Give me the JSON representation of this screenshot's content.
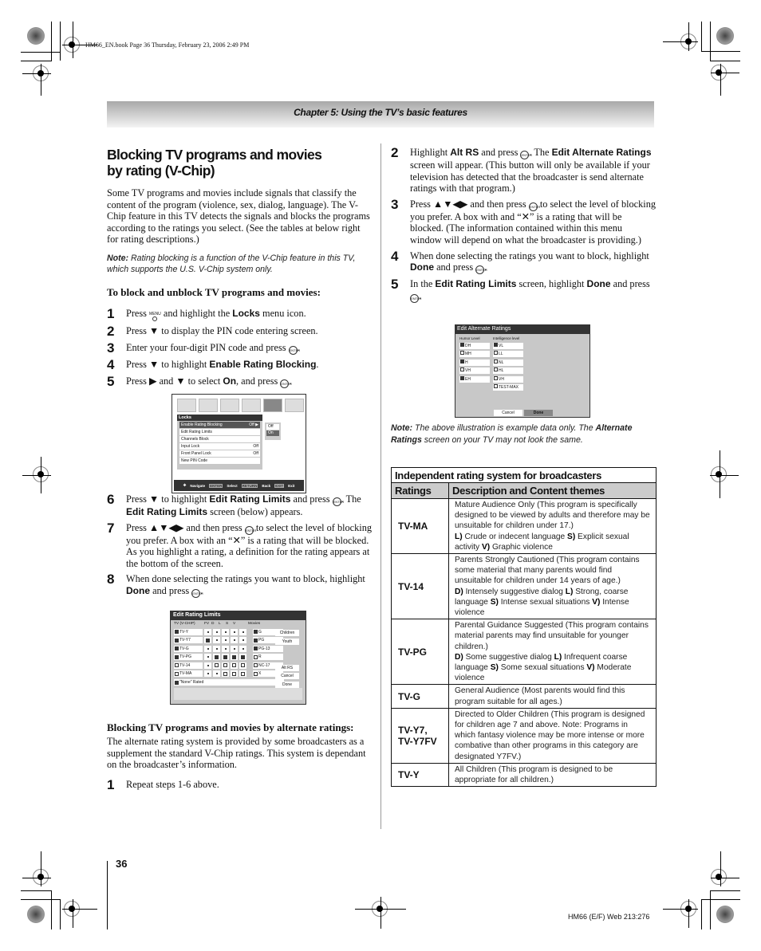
{
  "slug": "HM66_EN.book  Page 36  Thursday, February 23, 2006  2:49 PM",
  "chapter_header": "Chapter 5: Using the TV’s basic features",
  "left": {
    "title_line1": "Blocking TV programs and movies",
    "title_line2": "by rating (V-Chip)",
    "intro": "Some TV programs and movies include signals that classify the content of the program (violence, sex, dialog, language). The V-Chip feature in this TV detects the signals and blocks the programs according to the ratings you select. (See the tables at below right for rating descriptions.)",
    "note_label": "Note:",
    "note_text": " Rating blocking is a function of the V-Chip feature in this TV, which supports the U.S. V-Chip system only.",
    "procedure_heading": "To block and unblock TV programs and movies:",
    "steps": [
      {
        "num": "1",
        "a": "Press ",
        "icon": "MENU",
        "b": " and highlight the ",
        "bold": "Locks",
        "c": " menu icon."
      },
      {
        "num": "2",
        "a": "Press ▼ to display the PIN code entering screen."
      },
      {
        "num": "3",
        "a": "Enter your four-digit PIN code and press ",
        "enter": true,
        "c": "."
      },
      {
        "num": "4",
        "a": "Press ▼ to highlight ",
        "bold": "Enable Rating Blocking",
        "c": "."
      },
      {
        "num": "5",
        "a": "Press ▶ and ▼ to select ",
        "bold": "On",
        "c": ", and press ",
        "enter": true,
        "d": "."
      },
      {
        "num": "6",
        "a": "Press ▼ to highlight ",
        "bold": "Edit Rating Limits",
        "c": " and press ",
        "enter": true,
        "d": ". The ",
        "bold2": "Edit Rating Limits",
        "e": " screen (below) appears."
      },
      {
        "num": "7",
        "a": "Press ▲▼◀▶ and then press ",
        "enter": true,
        "c": " to select the level of blocking you prefer. A box with an “✕” is a rating that will be blocked. As you highlight a rating, a definition for the rating appears at the bottom of the screen."
      },
      {
        "num": "8",
        "a": "When done selecting the ratings you want to block, highlight ",
        "bold": "Done",
        "c": " and press ",
        "enter": true,
        "d": "."
      }
    ],
    "alt_heading": "Blocking TV programs and movies by alternate ratings:",
    "alt_intro": "The alternate rating system is provided by some broadcasters as a supplement the standard V-Chip ratings. This system is dependant on the broadcaster’s information.",
    "alt_step1": {
      "num": "1",
      "a": "Repeat steps 1-6 above."
    }
  },
  "locks_screen": {
    "title": "Locks",
    "items": [
      {
        "label": "Enable Rating Blocking",
        "value": "Off  ▶"
      },
      {
        "label": "Edit Rating Limits",
        "value": ""
      },
      {
        "label": "Channels Block",
        "value": ""
      },
      {
        "label": "Input Lock",
        "value": "Off"
      },
      {
        "label": "Front Panel Lock",
        "value": "Off"
      },
      {
        "label": "New PIN Code",
        "value": ""
      }
    ],
    "popup": [
      "Off",
      "On"
    ],
    "nav": {
      "navigate": "Navigate",
      "select_key": "ENTER",
      "select": "Select",
      "back_key": "RETURN",
      "back": "Back",
      "exit_key": "EXIT",
      "exit": "Exit"
    }
  },
  "erl_screen": {
    "title": "Edit Rating Limits",
    "headers": [
      "TV (V-CHIP)",
      "FV",
      "D",
      "L",
      "S",
      "V",
      "Movies"
    ],
    "tv_rows": [
      {
        "label": "TV-Y",
        "cells": [
          "•",
          "•",
          "•",
          "•",
          "•"
        ],
        "movie": "G"
      },
      {
        "label": "TV-Y7",
        "cells": [
          "✓",
          "•",
          "•",
          "•",
          "•"
        ],
        "movie": "PG"
      },
      {
        "label": "TV-G",
        "cells": [
          "•",
          "•",
          "•",
          "•",
          "•"
        ],
        "movie": "PG-13"
      },
      {
        "label": "TV-PG",
        "cells": [
          "•",
          "✓",
          "✓",
          "✓",
          "✓"
        ],
        "movie": "R"
      },
      {
        "label": "TV-14",
        "cells": [
          "•",
          "✕",
          "✕",
          "✕",
          "✕"
        ],
        "movie": "NC-17"
      },
      {
        "label": "TV-MA",
        "cells": [
          "•",
          "•",
          "✕",
          "✕",
          "✕"
        ],
        "movie": "X"
      }
    ],
    "none_rated": "\"None\" Rated",
    "buttons": [
      "Children",
      "Youth",
      "Alt RS",
      "Cancel",
      "Done"
    ]
  },
  "right": {
    "steps": [
      {
        "num": "2",
        "a": "Highlight ",
        "bold": "Alt RS",
        "c": " and press ",
        "enter": true,
        "d": ". The ",
        "bold2": "Edit Alternate Ratings",
        "e": " screen will appear. (This button will only be available if your television has detected that the broadcaster is send alternate ratings with that program.)"
      },
      {
        "num": "3",
        "a": "Press ▲▼◀▶ and then press ",
        "enter": true,
        "c": " to select the level of blocking you prefer. A box with and “✕” is a rating that will be blocked. (The information contained within this menu window will depend on what the broadcaster is providing.)"
      },
      {
        "num": "4",
        "a": "When done selecting the ratings you want to block, highlight ",
        "bold": "Done",
        "c": " and press ",
        "enter": true,
        "d": "."
      },
      {
        "num": "5",
        "a": "In the ",
        "bold": "Edit Rating Limits",
        "c": " screen, highlight ",
        "bold2": "Done",
        "e": " and press ",
        "enter2": true,
        "f": "."
      }
    ],
    "note_label": "Note:",
    "note_text1": " The above illustration is example data only. The ",
    "note_bold": "Alternate Ratings",
    "note_text2": " screen on your TV may not look the same."
  },
  "ear_screen": {
    "title": "Edit Alternate Ratings",
    "humor_label": "Humor Level",
    "intel_label": "Intelligence level",
    "humor": [
      "DH",
      "MH",
      "H",
      "VH",
      "EH"
    ],
    "intel": [
      "VL",
      "LL",
      "NL",
      "HL",
      "VH",
      "TEST-MAX"
    ],
    "cancel": "Cancel",
    "done": "Done"
  },
  "rating_table": {
    "caption": "Independent rating system for broadcasters",
    "col1": "Ratings",
    "col2": "Description and Content themes",
    "rows": [
      {
        "rating": "TV-MA",
        "desc": "Mature Audience Only (This program is specifically designed to be viewed by adults and therefore may be unsuitable for children under 17.)",
        "themes": [
          [
            "L)",
            " Crude or indecent language  "
          ],
          [
            "S)",
            " Explicit sexual activity "
          ],
          [
            "V)",
            " Graphic violence"
          ]
        ]
      },
      {
        "rating": "TV-14",
        "desc": "Parents Strongly Cautioned (This program contains some material that many parents would find unsuitable for children under 14 years of age.)",
        "themes": [
          [
            "D)",
            " Intensely suggestive dialog  "
          ],
          [
            "L)",
            " Strong, coarse language "
          ],
          [
            "S)",
            " Intense sexual situations "
          ],
          [
            "V)",
            " Intense violence"
          ]
        ]
      },
      {
        "rating": "TV-PG",
        "desc": "Parental Guidance Suggested (This program contains material parents may find unsuitable for younger children.)",
        "themes": [
          [
            "D)",
            " Some suggestive dialog  "
          ],
          [
            "L)",
            " Infrequent coarse language "
          ],
          [
            "S)",
            " Some sexual situations  "
          ],
          [
            "V)",
            " Moderate violence"
          ]
        ]
      },
      {
        "rating": "TV-G",
        "desc": "General Audience (Most parents would find this program suitable for all ages.)",
        "themes": []
      },
      {
        "rating": "TV-Y7,\nTV-Y7FV",
        "desc": "Directed to Older Children (This program is designed for children age 7 and above. Note: Programs in which fantasy violence may be more intense or more combative than other programs in this category are designated Y7FV.)",
        "themes": []
      },
      {
        "rating": "TV-Y",
        "desc": "All Children (This program is designed to be appropriate for all children.)",
        "themes": []
      }
    ]
  },
  "page_number": "36",
  "footer_code": "HM66 (E/F) Web 213:276"
}
